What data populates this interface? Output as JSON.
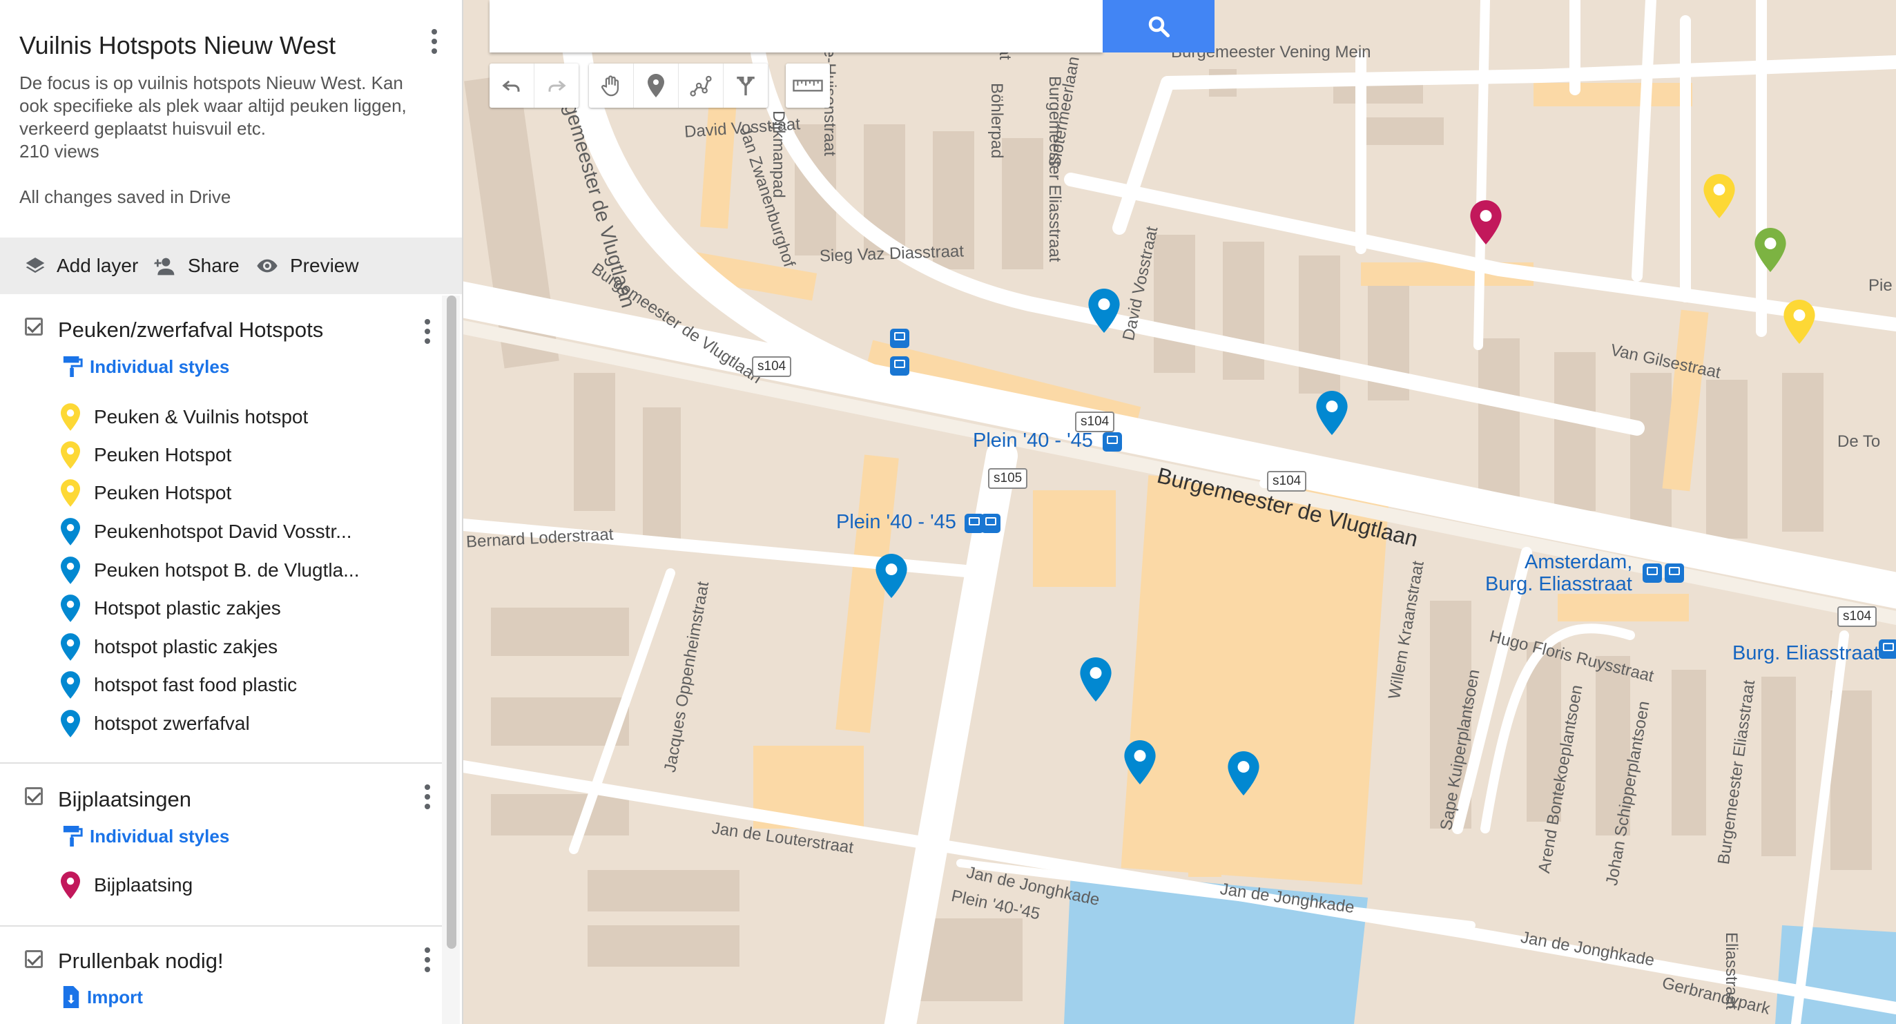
{
  "map_title": "Vuilnis Hotspots Nieuw West",
  "description_lines": [
    "De focus is op vuilnis hotspots Nieuw West. Kan",
    "ook specifieke als plek waar altijd peuken liggen,",
    "verkeerd geplaatst huisvuil etc."
  ],
  "views": "210 views",
  "save_status": "All changes saved in Drive",
  "toolbar": {
    "add_layer": "Add layer",
    "share": "Share",
    "preview": "Preview"
  },
  "layers": [
    {
      "name": "Peuken/zwerfafval Hotspots",
      "style_link": "Individual styles",
      "items": [
        {
          "label": "Peuken & Vuilnis hotspot",
          "color": "#fdd835"
        },
        {
          "label": "Peuken Hotspot",
          "color": "#fdd835"
        },
        {
          "label": "Peuken Hotspot",
          "color": "#fdd835"
        },
        {
          "label": "Peukenhotspot David Vosstr...",
          "color": "#0288d1"
        },
        {
          "label": "Peuken hotspot B. de Vlugtla...",
          "color": "#0288d1"
        },
        {
          "label": "Hotspot plastic zakjes",
          "color": "#0288d1"
        },
        {
          "label": "hotspot plastic zakjes",
          "color": "#0288d1"
        },
        {
          "label": "hotspot fast food plastic",
          "color": "#0288d1"
        },
        {
          "label": "hotspot zwerfafval",
          "color": "#0288d1"
        }
      ]
    },
    {
      "name": "Bijplaatsingen",
      "style_link": "Individual styles",
      "items": [
        {
          "label": "Bijplaatsing",
          "color": "#c2185b"
        }
      ]
    },
    {
      "name": "Prullenbak nodig!",
      "style_link": "Import",
      "items": []
    }
  ],
  "map_labels": {
    "streets": {
      "burg_vening": "Burgemeester Vening Mein",
      "david_vosstraat": "David Vosstraat",
      "dijkmanpad": "Dijkmanpad",
      "bohlerpad": "Böhlerpad",
      "bohlerpad_2": "Böhlerpad",
      "burg_eliasstraat": "Burgemeester Eliasstraat",
      "burg_eliasstraat_2": "Burgemeester Eliasstraat",
      "sieg_vaz": "Sieg Vaz Diasstraat",
      "pie": "Pie",
      "van_gilsestraat": "Van Gilsestraat",
      "de_to": "De To",
      "sloetermeerlaan": "Slotermeerlaan",
      "davd_vosstraat_vert": "David Vosstraat",
      "jan_zwanenburghof": "Jan Zwanenburghof",
      "gemeester_vlugtlaan": "gemeester de Vlugtlaan",
      "burg_vlugtlaan_diag": "Burgemeester de Vlugtlaan",
      "burg_vlugtlaan_main": "Burgemeester de Vlugtlaan",
      "bernard_loderstraat": "Bernard Loderstraat",
      "jacques_oppenheimstraat": "Jacques Oppenheimstraat",
      "willem_kraanstraat": "Willem Kraanstraat",
      "hugo_floris": "Hugo Floris Ruysstraat",
      "sape_kuiperplantsoen": "Sape Kuiperplantsoen",
      "arend_bontekoeplantsoen": "Arend Bontekoeplantsoen",
      "johan_schipperplantsoen": "Johan Schipperplantsoen",
      "jan_de_louterstraat": "Jan de Louterstraat",
      "jan_de_jonghkade_1": "Jan de Jonghkade",
      "jan_de_jonghkade_2": "Jan de Jonghkade",
      "jan_de_jonghkade_3": "Jan de Jonghkade",
      "plein_small": "Plein '40-'45",
      "gerbrandypark": "Gerbrandypark",
      "kasstraat": "anstraat",
      "kasstraat2": "sstraat",
      "kasstraat3": "sstraat",
      "huisenstraat": "e-Huisenstraat",
      "eliasstraat_bottom": "Eliasstraat"
    },
    "transit": {
      "plein_1": "Plein '40 - '45",
      "plein_2": "Plein '40 - '45",
      "amsterdam": "Amsterdam,",
      "burg_elias": "Burg. Eliasstraat",
      "burg_elias_2": "Burg. Eliasstraat"
    },
    "shields": {
      "s104_a": "s104",
      "s104_b": "s104",
      "s104_c": "s104",
      "s104_d": "s104",
      "s105": "s105"
    }
  },
  "colors": {
    "blue_pin": "#0288d1",
    "yellow_pin": "#fdd835",
    "green_pin": "#7cb342",
    "red_pin": "#c2185b",
    "accent": "#1a73e8",
    "search_button": "#4285f4",
    "water": "#9fd0ed"
  },
  "icons": [
    "search-icon",
    "undo-icon",
    "redo-icon",
    "hand-icon",
    "marker-icon",
    "draw-line-icon",
    "directions-icon",
    "ruler-icon",
    "layers-icon",
    "add-person-icon",
    "eye-icon",
    "paint-roller-icon",
    "import-icon",
    "more-vert-icon",
    "checkbox-icon",
    "map-pin-icon"
  ]
}
